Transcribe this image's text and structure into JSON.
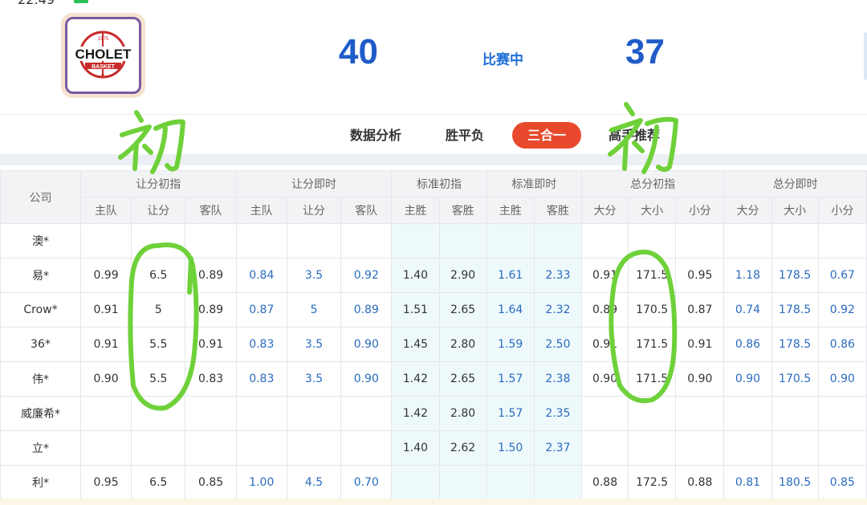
{
  "status_bar": {
    "time": "22:49"
  },
  "match": {
    "home_score": "40",
    "away_score": "37",
    "status": "比赛中",
    "home_logo_text": [
      "CHOLET",
      "BASKET",
      "1975"
    ]
  },
  "tabs": [
    {
      "label": "数据分析",
      "active": false
    },
    {
      "label": "胜平负",
      "active": false
    },
    {
      "label": "三合一",
      "active": true
    },
    {
      "label": "高手推荐",
      "active": false
    }
  ],
  "table": {
    "company_header": "公司",
    "groups": [
      "让分初指",
      "让分即时",
      "标准初指",
      "标准即时",
      "总分初指",
      "总分即时"
    ],
    "subheaders": [
      "主队",
      "让分",
      "客队",
      "主队",
      "让分",
      "客队",
      "主胜",
      "客胜",
      "主胜",
      "客胜",
      "大分",
      "大小",
      "小分",
      "大分",
      "大小",
      "小分"
    ],
    "rows": [
      [
        "澳*",
        "",
        "",
        "",
        "",
        "",
        "",
        "",
        "",
        "",
        "",
        "",
        "",
        "",
        "",
        "",
        ""
      ],
      [
        "易*",
        "0.99",
        "6.5",
        "0.89",
        "0.84",
        "3.5",
        "0.92",
        "1.40",
        "2.90",
        "1.61",
        "2.33",
        "0.91",
        "171.5",
        "0.95",
        "1.18",
        "178.5",
        "0.67"
      ],
      [
        "Crow*",
        "0.91",
        "5",
        "0.89",
        "0.87",
        "5",
        "0.89",
        "1.51",
        "2.65",
        "1.64",
        "2.32",
        "0.89",
        "170.5",
        "0.87",
        "0.74",
        "178.5",
        "0.92"
      ],
      [
        "36*",
        "0.91",
        "5.5",
        "0.91",
        "0.83",
        "3.5",
        "0.90",
        "1.45",
        "2.80",
        "1.59",
        "2.50",
        "0.91",
        "171.5",
        "0.91",
        "0.86",
        "178.5",
        "0.86"
      ],
      [
        "伟*",
        "0.90",
        "5.5",
        "0.83",
        "0.83",
        "3.5",
        "0.90",
        "1.42",
        "2.65",
        "1.57",
        "2.38",
        "0.90",
        "171.5",
        "0.90",
        "0.90",
        "170.5",
        "0.90"
      ],
      [
        "威廉希*",
        "",
        "",
        "",
        "",
        "",
        "",
        "1.42",
        "2.80",
        "1.57",
        "2.35",
        "",
        "",
        "",
        "",
        "",
        ""
      ],
      [
        "立*",
        "",
        "",
        "",
        "",
        "",
        "",
        "1.40",
        "2.62",
        "1.50",
        "2.37",
        "",
        "",
        "",
        "",
        "",
        ""
      ],
      [
        "利*",
        "0.95",
        "6.5",
        "0.85",
        "1.00",
        "4.5",
        "0.70",
        "",
        "",
        "",
        "",
        "0.88",
        "172.5",
        "0.88",
        "0.81",
        "180.5",
        "0.85"
      ]
    ]
  },
  "annotations": {
    "handwritten_left": "初",
    "handwritten_right": "初",
    "ink_color": "#6fd13a"
  },
  "colors": {
    "score": "#1f5cc8",
    "accent": "#e8492c",
    "live_value": "#2a6bbf",
    "standard_bg": "#eef9fb"
  }
}
